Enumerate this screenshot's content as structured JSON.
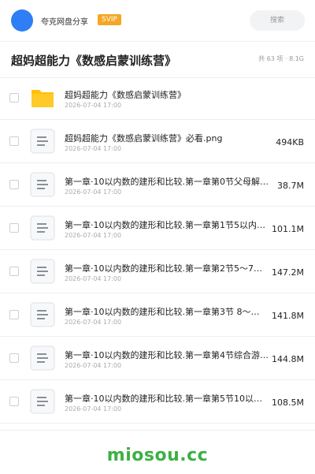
{
  "header": {
    "share_user": "夸克网盘分享",
    "badge": "SVIP",
    "search_placeholder": "搜索"
  },
  "folder": {
    "title": "超妈超能力《数感启蒙训练营》",
    "meta": "共 63 项 · 8.1G"
  },
  "files": [
    {
      "icon": "folder-icon",
      "name": "超妈超能力《数感启蒙训练营》",
      "date": "2026-07-04 17:00",
      "size": ""
    },
    {
      "icon": "document-icon",
      "name": "超妈超能力《数感启蒙训练营》必看.png",
      "date": "2026-07-04 17:00",
      "size": "494KB"
    },
    {
      "icon": "document-icon",
      "name": "第一章·10以内数的建形和比较.第一章第0节父母解…",
      "date": "2026-07-04 17:00",
      "size": "38.7M"
    },
    {
      "icon": "document-icon",
      "name": "第一章·10以内数的建形和比较.第一章第1节5以内…",
      "date": "2026-07-04 17:00",
      "size": "101.1M"
    },
    {
      "icon": "document-icon",
      "name": "第一章·10以内数的建形和比较.第一章第2节5～7…",
      "date": "2026-07-04 17:00",
      "size": "147.2M"
    },
    {
      "icon": "document-icon",
      "name": "第一章·10以内数的建形和比较.第一章第3节 8～…",
      "date": "2026-07-04 17:00",
      "size": "141.8M"
    },
    {
      "icon": "document-icon",
      "name": "第一章·10以内数的建形和比较.第一章第4节综合游…",
      "date": "2026-07-04 17:00",
      "size": "144.8M"
    },
    {
      "icon": "document-icon",
      "name": "第一章·10以内数的建形和比较.第一章第5节10以…",
      "date": "2026-07-04 17:00",
      "size": "108.5M"
    }
  ],
  "watermark": "miosou.cc",
  "colors": {
    "accent": "#2f7ef6",
    "badge": "#f5a623",
    "folder": "#ffc107",
    "watermark": "#3cb043"
  }
}
